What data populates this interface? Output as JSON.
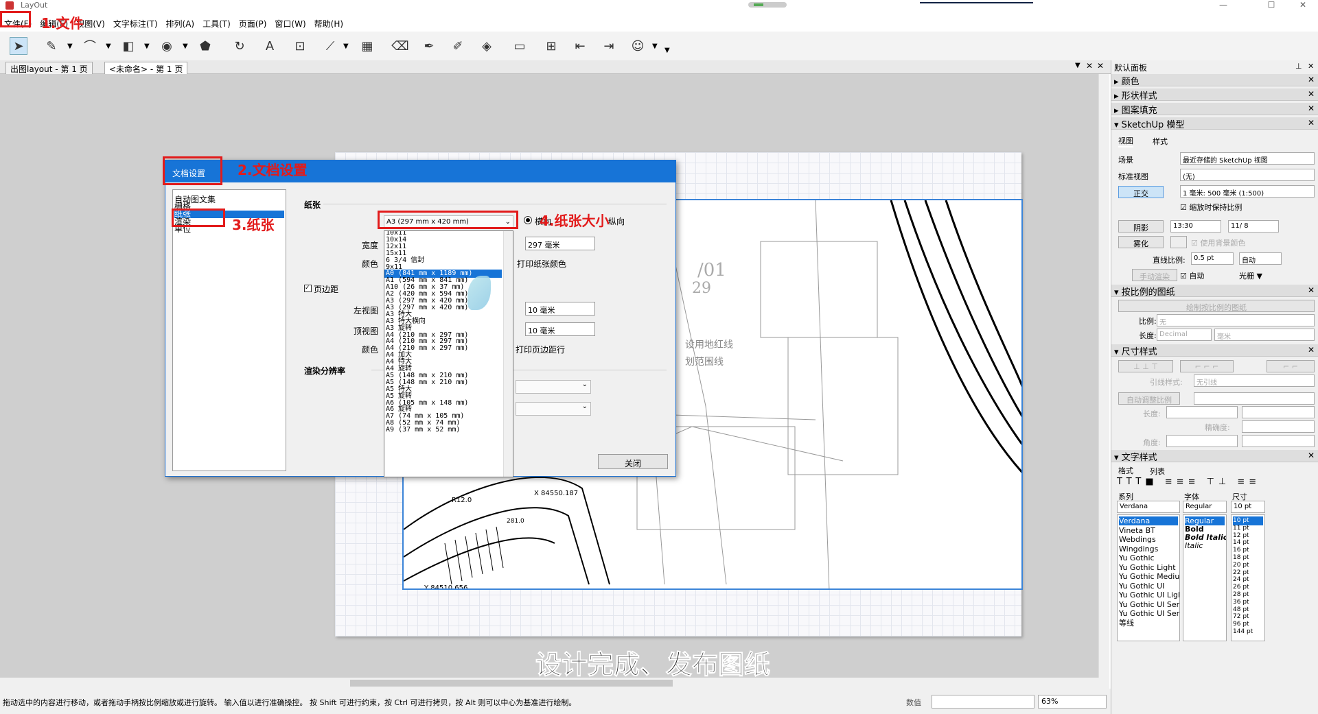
{
  "window": {
    "title": "LayOut",
    "min": "—",
    "max": "☐",
    "close": "✕"
  },
  "menu": [
    "文件(F)",
    "编辑(E)",
    "视图(V)",
    "文字标注(T)",
    "排列(A)",
    "工具(T)",
    "页面(P)",
    "窗口(W)",
    "帮助(H)"
  ],
  "tabs": [
    "出图layout - 第 1 页",
    "<未命名> - 第 1 页"
  ],
  "dialog": {
    "title": "文档设置",
    "nav": [
      "自动图文集",
      "栅格",
      "纸张",
      "渲染",
      "单位"
    ],
    "nav_selected": "纸张",
    "paper_section": "纸张",
    "paper_size": "A3 (297 mm x 420 mm)",
    "orientation_landscape": "横向",
    "orientation_portrait": "纵向",
    "width_label": "宽度",
    "width_value": "297 毫米",
    "color_label": "颜色",
    "print_paper_color": "打印纸张颜色",
    "margin_section": "页边距",
    "left_label": "左视图",
    "left_value": "10 毫米",
    "top_label": "顶视图",
    "top_value": "10 毫米",
    "margin_color_label": "颜色",
    "print_margin": "打印页边距行",
    "render_section": "渲染分辨率",
    "close": "关闭",
    "paper_options": [
      "10x11",
      "10x14",
      "12x11",
      "15x11",
      "6 3/4 信封",
      "9x11",
      "A0 (841 mm x 1189 mm)",
      "A1 (594 mm x 841 mm)",
      "A10 (26 mm x 37 mm)",
      "A2 (420 mm x 594 mm)",
      "A3 (297 mm x 420 mm)",
      "A3 (297 mm x 420 mm)",
      "A3 特大",
      "A3 特大横向",
      "A3 旋转",
      "A4 (210 mm x 297 mm)",
      "A4 (210 mm x 297 mm)",
      "A4 (210 mm x 297 mm)",
      "A4 加大",
      "A4 特大",
      "A4 旋转",
      "A5 (148 mm x 210 mm)",
      "A5 (148 mm x 210 mm)",
      "A5 特大",
      "A5 旋转",
      "A6 (105 mm x 148 mm)",
      "A6 旋转",
      "A7 (74 mm x 105 mm)",
      "A8 (52 mm x 74 mm)",
      "A9 (37 mm x 52 mm)"
    ],
    "paper_option_selected": "A0 (841 mm x 1189 mm)"
  },
  "annotations": {
    "a1": "1.文件",
    "a2": "2.文档设置",
    "a3": "3.纸张",
    "a4": "4.纸张大小"
  },
  "subtitle": "设计完成、发布图纸",
  "drawing_text": {
    "t1": "/01",
    "t2": "29",
    "t3": "设用地红线",
    "t4": "划范围线",
    "t5": "X 84550.187",
    "t6": "Y 84510.656",
    "t7": "R12.0",
    "t8": "281.0"
  },
  "status": {
    "message": "拖动选中的内容进行移动，或者拖动手柄按比例缩放或进行旋转。 输入值以进行准确操控。 按 Shift 可进行约束，按 Ctrl 可进行拷贝，按 Alt 则可以中心为基准进行绘制。",
    "value_label": "数值",
    "zoom": "63%"
  },
  "panel": {
    "title": "默认面板",
    "sections": {
      "color": "颜色",
      "shape": "形状样式",
      "pattern": "图案填充",
      "sketchup": "SketchUp 模型",
      "scaled": "按比例的图纸",
      "dim": "尺寸样式",
      "text": "文字样式"
    },
    "su": {
      "tab_view": "视图",
      "tab_style": "样式",
      "scene_label": "场景",
      "scene_value": "最近存储的 SketchUp 视图",
      "stdview_label": "标准视图",
      "stdview_value": "(无)",
      "ortho": "正交",
      "scale_value": "1 毫米: 500 毫米 (1:500)",
      "keep_scale": "缩放时保持比例",
      "shadow": "阴影",
      "time": "13:30",
      "date": "11/ 8",
      "fog": "雾化",
      "use_bg": "使用背景颜色",
      "line_scale_label": "直线比例:",
      "line_scale": "0.5 pt",
      "auto": "自动",
      "manual_render": "手动渲染",
      "auto_chk": "自动",
      "raster": "光栅"
    },
    "scaled": {
      "btn": "绘制按比例的图纸",
      "ratio_label": "比例:",
      "ratio": "无",
      "length_label": "长度:",
      "length": "Decimal",
      "unit": "毫米"
    },
    "dim": {
      "leader_label": "引线样式:",
      "leader": "无引线",
      "auto_scale": "自动调整比例",
      "length_label": "长度:",
      "precision_label": "精确度:",
      "angle_label": "角度:"
    },
    "text": {
      "tab_format": "格式",
      "tab_list": "列表",
      "family_label": "系列",
      "style_label": "字体",
      "size_label": "尺寸",
      "family": "Verdana",
      "style": "Regular",
      "size": "10 pt",
      "families": [
        "Verdana",
        "Vineta BT",
        "Webdings",
        "Wingdings",
        "Yu Gothic",
        "Yu Gothic Light",
        "Yu Gothic Medium",
        "Yu Gothic UI",
        "Yu Gothic UI Light",
        "Yu Gothic UI Semibold",
        "Yu Gothic UI Semilight",
        "等线"
      ],
      "styles": [
        "Regular",
        "Bold",
        "Bold Italic",
        "Italic"
      ],
      "sizes": [
        "10 pt",
        "11 pt",
        "12 pt",
        "14 pt",
        "16 pt",
        "18 pt",
        "20 pt",
        "22 pt",
        "24 pt",
        "26 pt",
        "28 pt",
        "36 pt",
        "48 pt",
        "72 pt",
        "96 pt",
        "144 pt"
      ]
    }
  }
}
